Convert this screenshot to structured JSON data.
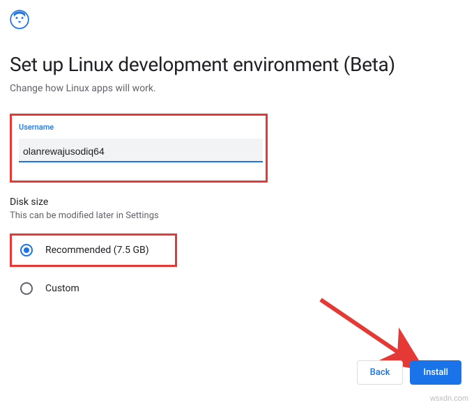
{
  "header": {
    "title": "Set up Linux development environment (Beta)",
    "subtitle": "Change how Linux apps will work."
  },
  "username": {
    "label": "Username",
    "value": "olanrewajusodiq64"
  },
  "disk": {
    "label": "Disk size",
    "hint": "This can be modified later in Settings",
    "options": {
      "recommended": "Recommended (7.5 GB)",
      "custom": "Custom"
    }
  },
  "buttons": {
    "back": "Back",
    "install": "Install"
  },
  "watermark": "wsxdn.com"
}
